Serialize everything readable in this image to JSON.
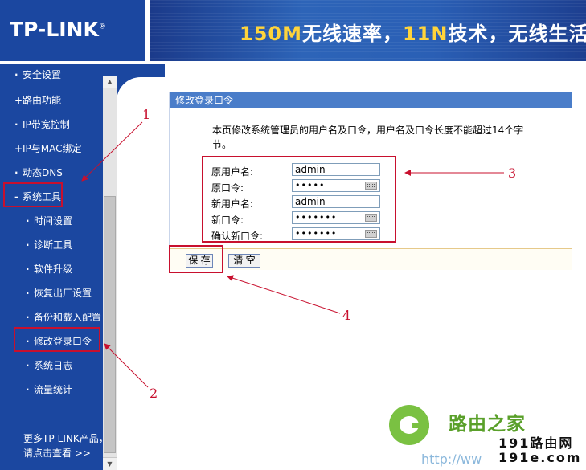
{
  "header": {
    "logo": "TP-LINK",
    "logo_mark": "®",
    "banner_parts": [
      {
        "text": "150M",
        "highlight": true
      },
      {
        "text": "无线速率，",
        "highlight": false
      },
      {
        "text": "11N",
        "highlight": true
      },
      {
        "text": "技术，无线生活新",
        "highlight": false
      }
    ]
  },
  "sidebar": {
    "partial_item": "安全设置",
    "items": [
      {
        "bullet": "+",
        "label": "路由功能"
      },
      {
        "bullet": "·",
        "label": "IP带宽控制"
      },
      {
        "bullet": "+",
        "label": "IP与MAC绑定"
      },
      {
        "bullet": "·",
        "label": "动态DNS"
      },
      {
        "bullet": "-",
        "label": "系统工具"
      }
    ],
    "sub_items": [
      {
        "bullet": "·",
        "label": "时间设置"
      },
      {
        "bullet": "·",
        "label": "诊断工具"
      },
      {
        "bullet": "·",
        "label": "软件升级"
      },
      {
        "bullet": "·",
        "label": "恢复出厂设置"
      },
      {
        "bullet": "·",
        "label": "备份和载入配置"
      },
      {
        "bullet": "·",
        "label": "修改登录口令"
      },
      {
        "bullet": "·",
        "label": "系统日志"
      },
      {
        "bullet": "·",
        "label": "流量统计"
      }
    ],
    "more_line1": "更多TP-LINK产品，",
    "more_line2": "请点击查看 >>"
  },
  "panel": {
    "title": "修改登录口令",
    "desc_line1": "本页修改系统管理员的用户名及口令，用户名及口令长度不能超过14个字",
    "desc_line2": "节。",
    "fields": [
      {
        "label": "原用户名:",
        "value": "admin"
      },
      {
        "label": "原口令:",
        "value": "•••••"
      },
      {
        "label": "新用户名:",
        "value": "admin"
      },
      {
        "label": "新口令:",
        "value": "•••••••"
      },
      {
        "label": "确认新口令:",
        "value": "•••••••"
      }
    ],
    "save_label": "保 存",
    "clear_label": "清 空"
  },
  "annotations": {
    "n1": "1",
    "n2": "2",
    "n3": "3",
    "n4": "4",
    "color": "#c8102e"
  },
  "watermark": {
    "name": "路由之家",
    "url1": "191路由网",
    "url2": "191e.com",
    "http": "http://ww"
  },
  "colors": {
    "sidebar": "#1b47a0",
    "panel_title": "#4a7dc9",
    "annotation": "#c8102e",
    "watermark": "#7ac142"
  }
}
